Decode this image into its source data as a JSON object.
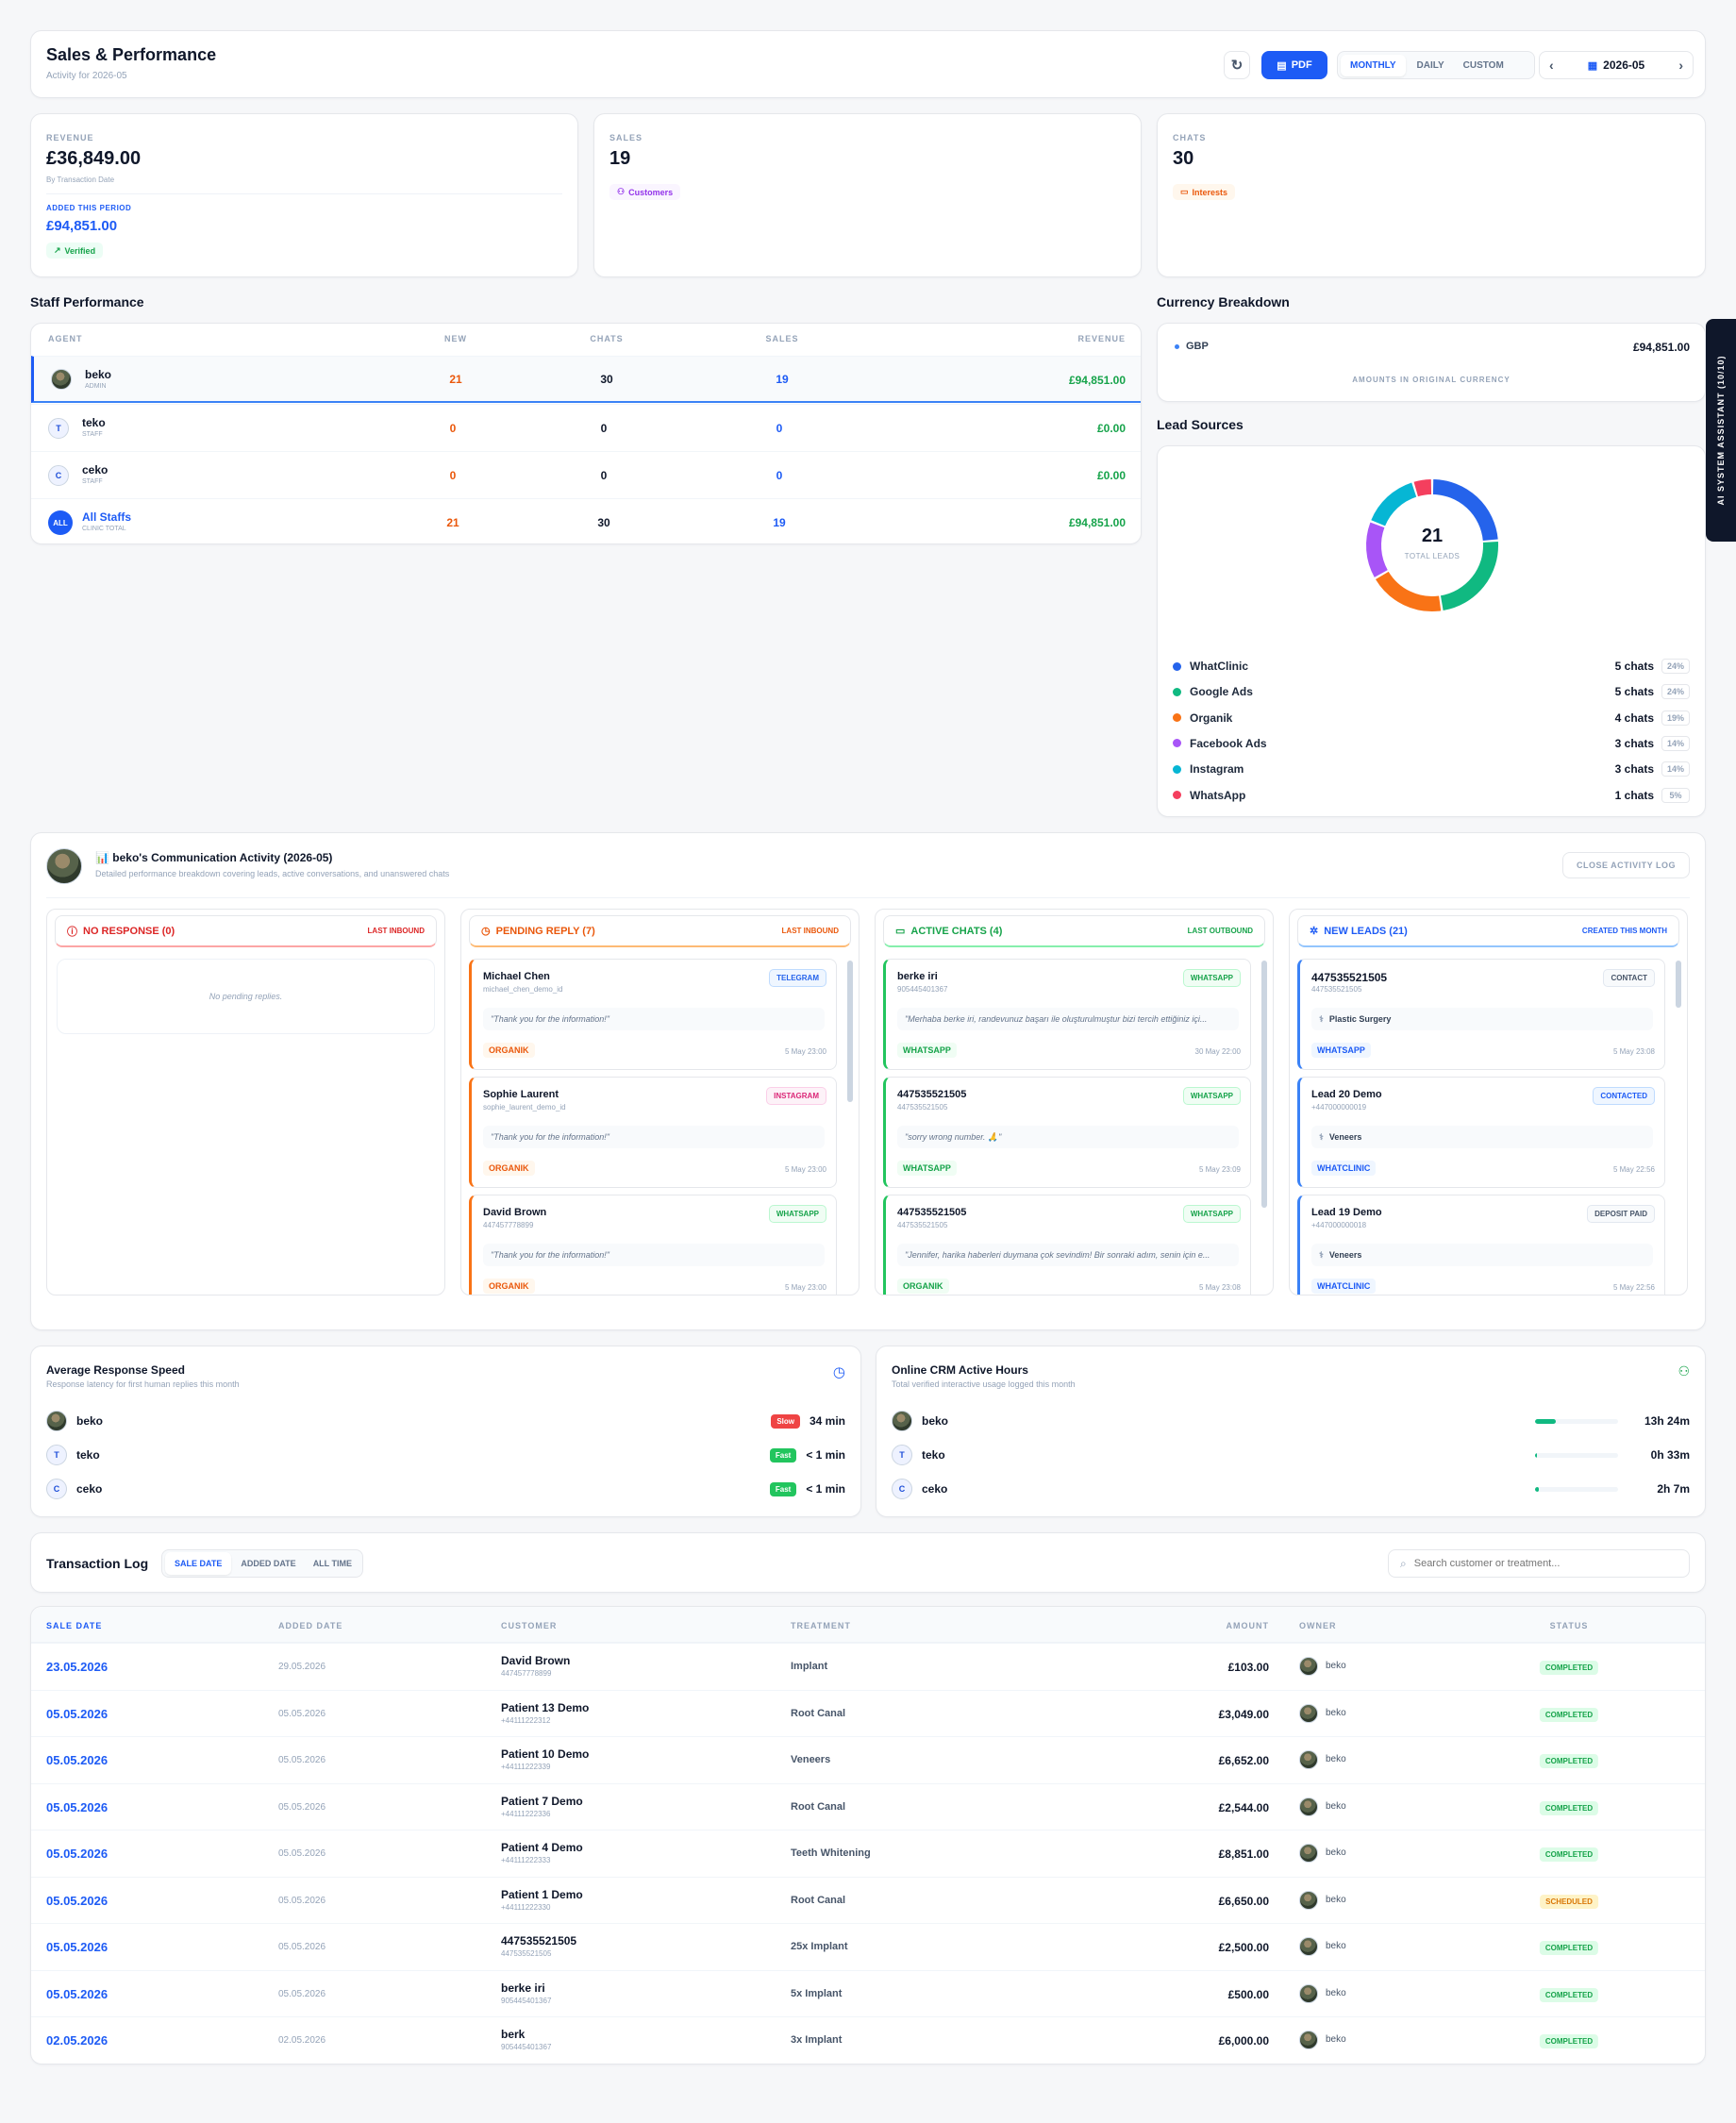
{
  "header": {
    "title": "Sales & Performance",
    "subtitle": "Activity for 2026-05",
    "pdf_label": "PDF",
    "modes": [
      "MONTHLY",
      "DAILY",
      "CUSTOM"
    ],
    "period": "2026-05"
  },
  "stats": {
    "revenue": {
      "label": "REVENUE",
      "value": "£36,849.00",
      "note": "By Transaction Date",
      "added_label": "ADDED THIS PERIOD",
      "added_value": "£94,851.00",
      "badge": "Verified"
    },
    "sales": {
      "label": "SALES",
      "value": "19",
      "badge": "Customers"
    },
    "chats": {
      "label": "CHATS",
      "value": "30",
      "badge": "Interests"
    }
  },
  "staff": {
    "title": "Staff Performance",
    "columns": [
      "AGENT",
      "NEW",
      "CHATS",
      "SALES",
      "REVENUE"
    ],
    "rows": [
      {
        "name": "beko",
        "role": "ADMIN",
        "avatar": "",
        "new": "21",
        "chats": "30",
        "sales": "19",
        "revenue": "£94,851.00"
      },
      {
        "name": "teko",
        "role": "STAFF",
        "avatar": "T",
        "new": "0",
        "chats": "0",
        "sales": "0",
        "revenue": "£0.00"
      },
      {
        "name": "ceko",
        "role": "STAFF",
        "avatar": "C",
        "new": "0",
        "chats": "0",
        "sales": "0",
        "revenue": "£0.00"
      },
      {
        "name": "All Staffs",
        "role": "CLINIC TOTAL",
        "avatar": "ALL",
        "new": "21",
        "chats": "30",
        "sales": "19",
        "revenue": "£94,851.00"
      }
    ]
  },
  "currency": {
    "title": "Currency Breakdown",
    "code": "GBP",
    "amount": "£94,851.00",
    "note": "AMOUNTS IN ORIGINAL CURRENCY"
  },
  "ai_tab": "AI SYSTEM ASSISTANT (10/10)",
  "lead_sources": {
    "title": "Lead Sources",
    "total": "21",
    "total_label": "TOTAL LEADS",
    "chart_data": {
      "type": "pie",
      "categories": [
        "WhatClinic",
        "Google Ads",
        "Organik",
        "Facebook Ads",
        "Instagram",
        "WhatsApp"
      ],
      "values": [
        5,
        5,
        4,
        3,
        3,
        1
      ],
      "colors": [
        "#2563eb",
        "#10b981",
        "#f97316",
        "#a855f7",
        "#06b6d4",
        "#f43f5e"
      ]
    },
    "legend": [
      {
        "name": "WhatClinic",
        "count": "5 chats",
        "pct": "24%"
      },
      {
        "name": "Google Ads",
        "count": "5 chats",
        "pct": "24%"
      },
      {
        "name": "Organik",
        "count": "4 chats",
        "pct": "19%"
      },
      {
        "name": "Facebook Ads",
        "count": "3 chats",
        "pct": "14%"
      },
      {
        "name": "Instagram",
        "count": "3 chats",
        "pct": "14%"
      },
      {
        "name": "WhatsApp",
        "count": "1 chats",
        "pct": "5%"
      }
    ]
  },
  "activity": {
    "title": "📊 beko's Communication Activity (2026-05)",
    "subtitle": "Detailed performance breakdown covering leads, active conversations, and unanswered chats",
    "close_label": "CLOSE ACTIVITY LOG",
    "columns": [
      {
        "title": "NO RESPONSE (0)",
        "tag": "LAST INBOUND",
        "empty": "No pending replies.",
        "cards": []
      },
      {
        "title": "PENDING REPLY (7)",
        "tag": "LAST INBOUND",
        "cards": [
          {
            "name": "Michael Chen",
            "sub": "michael_chen_demo_id",
            "badge": "TELEGRAM",
            "msg": "\"Thank you for the information!\"",
            "source": "ORGANIK",
            "time": "5 May 23:00"
          },
          {
            "name": "Sophie Laurent",
            "sub": "sophie_laurent_demo_id",
            "badge": "INSTAGRAM",
            "msg": "\"Thank you for the information!\"",
            "source": "ORGANIK",
            "time": "5 May 23:00"
          },
          {
            "name": "David Brown",
            "sub": "447457778899",
            "badge": "WHATSAPP",
            "msg": "\"Thank you for the information!\"",
            "source": "ORGANIK",
            "time": "5 May 23:00"
          }
        ]
      },
      {
        "title": "ACTIVE CHATS (4)",
        "tag": "LAST OUTBOUND",
        "cards": [
          {
            "name": "berke iri",
            "sub": "905445401367",
            "badge": "WHATSAPP",
            "msg": "\"Merhaba berke iri, randevunuz başarı ile oluşturulmuştur bizi tercih ettiğiniz içi...",
            "source": "WHATSAPP",
            "time": "30 May 22:00"
          },
          {
            "name": "447535521505",
            "sub": "447535521505",
            "badge": "WHATSAPP",
            "msg": "\"sorry wrong number. 🙏\"",
            "source": "WHATSAPP",
            "time": "5 May 23:09"
          },
          {
            "name": "447535521505",
            "sub": "447535521505",
            "badge": "WHATSAPP",
            "msg": "\"Jennifer, harika haberleri duymana çok sevindim! Bir sonraki adım, senin için e...",
            "source": "ORGANIK",
            "time": "5 May 23:08"
          }
        ]
      },
      {
        "title": "NEW LEADS (21)",
        "tag": "CREATED THIS MONTH",
        "cards": [
          {
            "name": "447535521505",
            "sub": "447535521505",
            "badge": "CONTACT",
            "msg": "Plastic Surgery",
            "source": "WHATSAPP",
            "time": "5 May 23:08"
          },
          {
            "name": "Lead 20 Demo",
            "sub": "+447000000019",
            "badge": "CONTACTED",
            "msg": "Veneers",
            "source": "WHATCLINIC",
            "time": "5 May 22:56"
          },
          {
            "name": "Lead 19 Demo",
            "sub": "+447000000018",
            "badge": "DEPOSIT PAID",
            "msg": "Veneers",
            "source": "WHATCLINIC",
            "time": "5 May 22:56"
          }
        ]
      }
    ]
  },
  "response": {
    "title": "Average Response Speed",
    "subtitle": "Response latency for first human replies this month",
    "rows": [
      {
        "name": "beko",
        "avatar": "",
        "badge": "Slow",
        "value": "34 min"
      },
      {
        "name": "teko",
        "avatar": "T",
        "badge": "Fast",
        "value": "< 1 min"
      },
      {
        "name": "ceko",
        "avatar": "C",
        "badge": "Fast",
        "value": "< 1 min"
      }
    ]
  },
  "online": {
    "title": "Online CRM Active Hours",
    "subtitle": "Total verified interactive usage logged this month",
    "rows": [
      {
        "name": "beko",
        "avatar": "",
        "value": "13h 24m",
        "fill": 0.25
      },
      {
        "name": "teko",
        "avatar": "T",
        "value": "0h 33m",
        "fill": 0.02
      },
      {
        "name": "ceko",
        "avatar": "C",
        "value": "2h 7m",
        "fill": 0.04
      }
    ]
  },
  "transactions": {
    "title": "Transaction Log",
    "tabs": [
      "SALE DATE",
      "ADDED DATE",
      "ALL TIME"
    ],
    "search_placeholder": "Search customer or treatment...",
    "columns": [
      "SALE DATE",
      "ADDED DATE",
      "CUSTOMER",
      "TREATMENT",
      "AMOUNT",
      "OWNER",
      "STATUS"
    ],
    "rows": [
      {
        "sale": "23.05.2026",
        "added": "29.05.2026",
        "customer": "David Brown",
        "phone": "447457778899",
        "treatment": "Implant",
        "amount": "£103.00",
        "owner": "beko",
        "status": "COMPLETED"
      },
      {
        "sale": "05.05.2026",
        "added": "05.05.2026",
        "customer": "Patient 13 Demo",
        "phone": "+44111222312",
        "treatment": "Root Canal",
        "amount": "£3,049.00",
        "owner": "beko",
        "status": "COMPLETED"
      },
      {
        "sale": "05.05.2026",
        "added": "05.05.2026",
        "customer": "Patient 10 Demo",
        "phone": "+44111222339",
        "treatment": "Veneers",
        "amount": "£6,652.00",
        "owner": "beko",
        "status": "COMPLETED"
      },
      {
        "sale": "05.05.2026",
        "added": "05.05.2026",
        "customer": "Patient 7 Demo",
        "phone": "+44111222336",
        "treatment": "Root Canal",
        "amount": "£2,544.00",
        "owner": "beko",
        "status": "COMPLETED"
      },
      {
        "sale": "05.05.2026",
        "added": "05.05.2026",
        "customer": "Patient 4 Demo",
        "phone": "+44111222333",
        "treatment": "Teeth Whitening",
        "amount": "£8,851.00",
        "owner": "beko",
        "status": "COMPLETED"
      },
      {
        "sale": "05.05.2026",
        "added": "05.05.2026",
        "customer": "Patient 1 Demo",
        "phone": "+44111222330",
        "treatment": "Root Canal",
        "amount": "£6,650.00",
        "owner": "beko",
        "status": "SCHEDULED"
      },
      {
        "sale": "05.05.2026",
        "added": "05.05.2026",
        "customer": "447535521505",
        "phone": "447535521505",
        "treatment": "25x Implant",
        "amount": "£2,500.00",
        "owner": "beko",
        "status": "COMPLETED"
      },
      {
        "sale": "05.05.2026",
        "added": "05.05.2026",
        "customer": "berke iri",
        "phone": "905445401367",
        "treatment": "5x Implant",
        "amount": "£500.00",
        "owner": "beko",
        "status": "COMPLETED"
      },
      {
        "sale": "02.05.2026",
        "added": "02.05.2026",
        "customer": "berk",
        "phone": "905445401367",
        "treatment": "3x Implant",
        "amount": "£6,000.00",
        "owner": "beko",
        "status": "COMPLETED"
      }
    ]
  },
  "colors": {
    "accent": "#1d5bf5",
    "green": "#16a34a",
    "orange": "#ea580c",
    "red": "#dc2626"
  }
}
